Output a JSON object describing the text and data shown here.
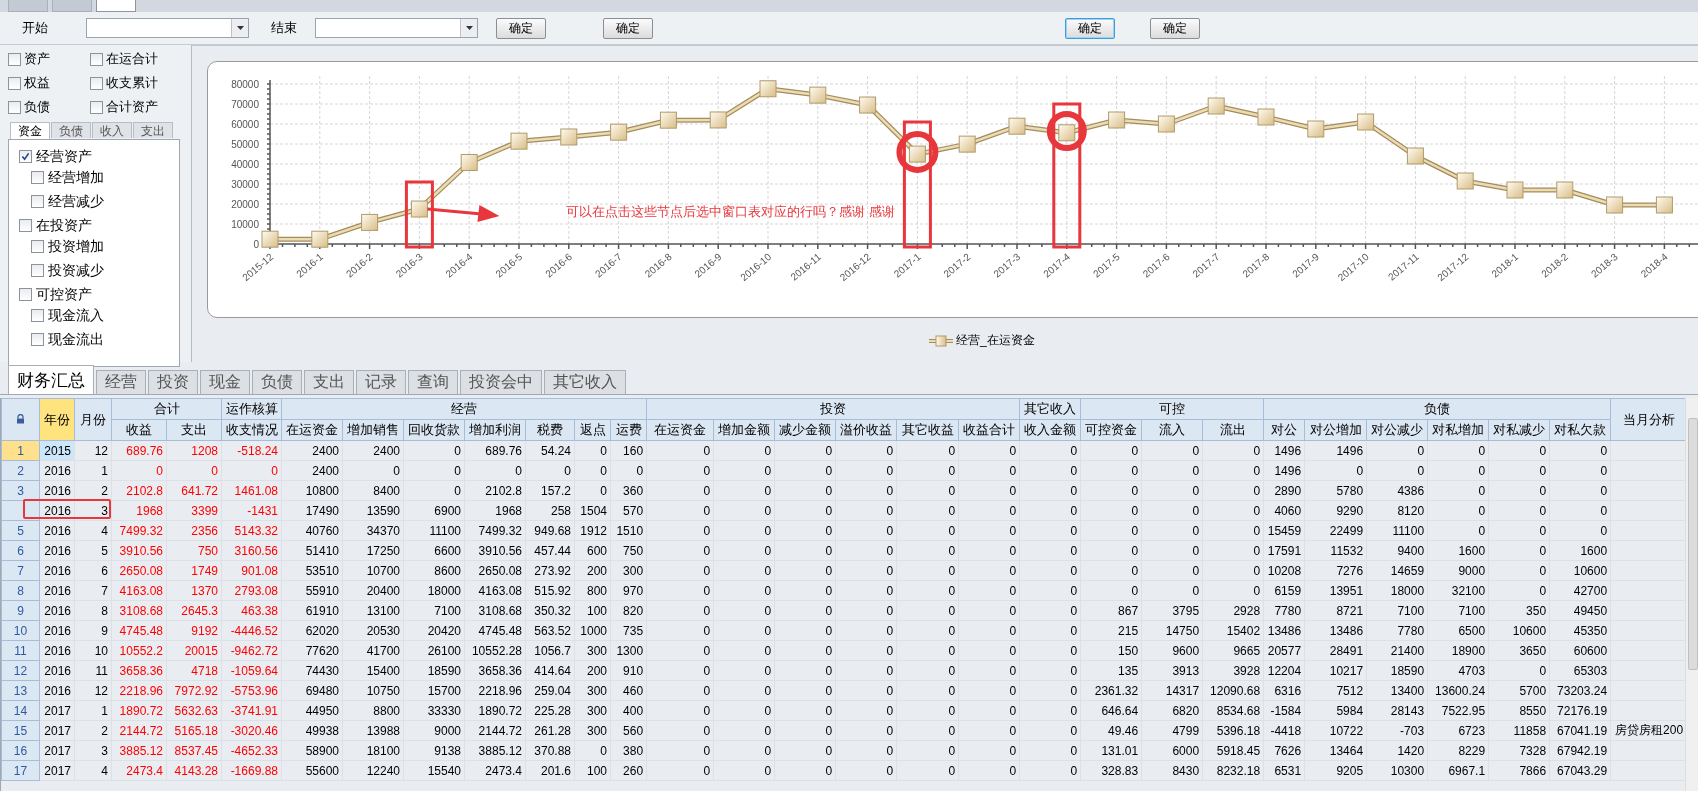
{
  "top_tabs": [
    {
      "selected": false
    },
    {
      "selected": false
    },
    {
      "selected": true
    }
  ],
  "toolbar": {
    "start_label": "开始",
    "end_label": "结束",
    "buttons": [
      {
        "label": "确定",
        "focused": false
      },
      {
        "label": "确定",
        "focused": false
      },
      {
        "label": "确定",
        "focused": true
      },
      {
        "label": "确定",
        "focused": false
      }
    ]
  },
  "left_panel": {
    "options": [
      {
        "label": "资产",
        "checked": false
      },
      {
        "label": "在运合计",
        "checked": false
      },
      {
        "label": "权益",
        "checked": false
      },
      {
        "label": "收支累计",
        "checked": false
      },
      {
        "label": "负债",
        "checked": false
      },
      {
        "label": "合计资产",
        "checked": false
      }
    ],
    "tabs": [
      {
        "label": "资金",
        "selected": true
      },
      {
        "label": "负债",
        "selected": false
      },
      {
        "label": "收入",
        "selected": false
      },
      {
        "label": "支出",
        "selected": false
      }
    ],
    "tree": [
      {
        "label": "经营资产",
        "checked": true,
        "children": [
          {
            "label": "经营增加",
            "checked": false
          },
          {
            "label": "经营减少",
            "checked": false
          }
        ]
      },
      {
        "label": "在投资产",
        "checked": false,
        "children": [
          {
            "label": "投资增加",
            "checked": false
          },
          {
            "label": "投资减少",
            "checked": false
          }
        ]
      },
      {
        "label": "可控资产",
        "checked": false,
        "children": [
          {
            "label": "现金流入",
            "checked": false
          },
          {
            "label": "现金流出",
            "checked": false
          }
        ]
      }
    ]
  },
  "chart_panel": {
    "chart_data": {
      "type": "line",
      "categories": [
        "2015-12",
        "2016-1",
        "2016-2",
        "2016-3",
        "2016-4",
        "2016-5",
        "2016-6",
        "2016-7",
        "2016-8",
        "2016-9",
        "2016-10",
        "2016-11",
        "2016-12",
        "2017-1",
        "2017-2",
        "2017-3",
        "2017-4",
        "2017-5",
        "2017-6",
        "2017-7",
        "2017-8",
        "2017-9",
        "2017-10",
        "2017-11",
        "2017-12",
        "2018-1",
        "2018-2",
        "2018-3",
        "2018-4"
      ],
      "series": [
        {
          "name": "经营_在运资金",
          "color": "#ecdcb4",
          "marker": "square",
          "values": [
            2400,
            2400,
            10800,
            17490,
            40760,
            51410,
            53510,
            55910,
            61910,
            62020,
            77620,
            74430,
            69480,
            44950,
            49938,
            58900,
            55600,
            62000,
            60000,
            69000,
            63500,
            57500,
            61000,
            44000,
            31500,
            27000,
            27000,
            19500,
            19500
          ]
        }
      ],
      "ylim": [
        0,
        80000
      ],
      "yticks": [
        0,
        10000,
        20000,
        30000,
        40000,
        50000,
        60000,
        70000,
        80000
      ],
      "grid": true,
      "annotations": [
        "可以在点击这些节点后选中窗口表对应的行吗？感谢 感谢"
      ]
    }
  },
  "bottom_tabs": [
    {
      "label": "财务汇总",
      "selected": true
    },
    {
      "label": "经营",
      "selected": false
    },
    {
      "label": "投资",
      "selected": false
    },
    {
      "label": "现金",
      "selected": false
    },
    {
      "label": "负债",
      "selected": false
    },
    {
      "label": "支出",
      "selected": false
    },
    {
      "label": "记录",
      "selected": false
    },
    {
      "label": "查询",
      "selected": false
    },
    {
      "label": "投资会中",
      "selected": false
    },
    {
      "label": "其它收入",
      "selected": false
    }
  ],
  "table": {
    "column_groups": [
      {
        "label": "年份",
        "selected": true
      },
      {
        "label": "月份",
        "selected": false
      },
      {
        "label": "合计",
        "selected": false,
        "columns": [
          {
            "label": "收益",
            "emphasis": true
          },
          {
            "label": "支出",
            "emphasis": true
          }
        ]
      },
      {
        "label": "运作核算",
        "selected": false,
        "columns": [
          {
            "label": "收支情况",
            "emphasis": true
          }
        ]
      },
      {
        "label": "经营",
        "selected": false,
        "columns": [
          {
            "label": "在运资金",
            "emphasis": false
          },
          {
            "label": "增加销售",
            "emphasis": false
          },
          {
            "label": "回收货款",
            "emphasis": false
          },
          {
            "label": "增加利润",
            "emphasis": false
          },
          {
            "label": "税费",
            "emphasis": false
          },
          {
            "label": "返点",
            "emphasis": false
          },
          {
            "label": "运费",
            "emphasis": false
          }
        ]
      },
      {
        "label": "投资",
        "selected": false,
        "columns": [
          {
            "label": "在运资金",
            "emphasis": false
          },
          {
            "label": "增加金额",
            "emphasis": false
          },
          {
            "label": "减少金额",
            "emphasis": false
          },
          {
            "label": "溢价收益",
            "emphasis": false
          },
          {
            "label": "其它收益",
            "emphasis": false
          },
          {
            "label": "收益合计",
            "emphasis": false
          }
        ]
      },
      {
        "label": "其它收入",
        "selected": false,
        "columns": [
          {
            "label": "收入金额",
            "emphasis": false
          }
        ]
      },
      {
        "label": "可控",
        "selected": false,
        "columns": [
          {
            "label": "可控资金",
            "emphasis": false
          },
          {
            "label": "流入",
            "emphasis": false
          },
          {
            "label": "流出",
            "emphasis": false
          }
        ]
      },
      {
        "label": "负债",
        "selected": false,
        "columns": [
          {
            "label": "对公",
            "emphasis": false
          },
          {
            "label": "对公增加",
            "emphasis": false
          },
          {
            "label": "对公减少",
            "emphasis": false
          },
          {
            "label": "对私增加",
            "emphasis": false
          },
          {
            "label": "对私减少",
            "emphasis": false
          },
          {
            "label": "对私欠款",
            "emphasis": false
          }
        ]
      },
      {
        "label": "当月分析",
        "selected": false
      }
    ],
    "rows": [
      {
        "no": "1",
        "selected": true,
        "marked": false,
        "cells": [
          "2015",
          "12",
          "689.76",
          "1208",
          "-518.24",
          "2400",
          "2400",
          "0",
          "689.76",
          "54.24",
          "0",
          "160",
          "0",
          "0",
          "0",
          "0",
          "0",
          "0",
          "0",
          "0",
          "0",
          "0",
          "1496",
          "1496",
          "0",
          "0",
          "0",
          "0",
          ""
        ]
      },
      {
        "no": "2",
        "selected": false,
        "marked": false,
        "cells": [
          "2016",
          "1",
          "0",
          "0",
          "0",
          "2400",
          "0",
          "0",
          "0",
          "0",
          "0",
          "0",
          "0",
          "0",
          "0",
          "0",
          "0",
          "0",
          "0",
          "0",
          "0",
          "0",
          "1496",
          "0",
          "0",
          "0",
          "0",
          "0",
          ""
        ]
      },
      {
        "no": "3",
        "selected": false,
        "marked": false,
        "cells": [
          "2016",
          "2",
          "2102.8",
          "641.72",
          "1461.08",
          "10800",
          "8400",
          "0",
          "2102.8",
          "157.2",
          "0",
          "360",
          "0",
          "0",
          "0",
          "0",
          "0",
          "0",
          "0",
          "0",
          "0",
          "0",
          "2890",
          "5780",
          "4386",
          "0",
          "0",
          "0",
          ""
        ]
      },
      {
        "selected": false,
        "marked": true,
        "cells": [
          "2016",
          "3",
          "1968",
          "3399",
          "-1431",
          "17490",
          "13590",
          "6900",
          "1968",
          "258",
          "1504",
          "570",
          "0",
          "0",
          "0",
          "0",
          "0",
          "0",
          "0",
          "0",
          "0",
          "0",
          "4060",
          "9290",
          "8120",
          "0",
          "0",
          "0",
          ""
        ]
      },
      {
        "no": "5",
        "selected": false,
        "marked": false,
        "cells": [
          "2016",
          "4",
          "7499.32",
          "2356",
          "5143.32",
          "40760",
          "34370",
          "11100",
          "7499.32",
          "949.68",
          "1912",
          "1510",
          "0",
          "0",
          "0",
          "0",
          "0",
          "0",
          "0",
          "0",
          "0",
          "0",
          "15459",
          "22499",
          "11100",
          "0",
          "0",
          "0",
          ""
        ]
      },
      {
        "no": "6",
        "selected": false,
        "marked": false,
        "cells": [
          "2016",
          "5",
          "3910.56",
          "750",
          "3160.56",
          "51410",
          "17250",
          "6600",
          "3910.56",
          "457.44",
          "600",
          "750",
          "0",
          "0",
          "0",
          "0",
          "0",
          "0",
          "0",
          "0",
          "0",
          "0",
          "17591",
          "11532",
          "9400",
          "1600",
          "0",
          "1600",
          ""
        ]
      },
      {
        "no": "7",
        "selected": false,
        "marked": false,
        "cells": [
          "2016",
          "6",
          "2650.08",
          "1749",
          "901.08",
          "53510",
          "10700",
          "8600",
          "2650.08",
          "273.92",
          "200",
          "300",
          "0",
          "0",
          "0",
          "0",
          "0",
          "0",
          "0",
          "0",
          "0",
          "0",
          "10208",
          "7276",
          "14659",
          "9000",
          "0",
          "10600",
          ""
        ]
      },
      {
        "no": "8",
        "selected": false,
        "marked": false,
        "cells": [
          "2016",
          "7",
          "4163.08",
          "1370",
          "2793.08",
          "55910",
          "20400",
          "18000",
          "4163.08",
          "515.92",
          "800",
          "970",
          "0",
          "0",
          "0",
          "0",
          "0",
          "0",
          "0",
          "0",
          "0",
          "0",
          "6159",
          "13951",
          "18000",
          "32100",
          "0",
          "42700",
          ""
        ]
      },
      {
        "no": "9",
        "selected": false,
        "marked": false,
        "cells": [
          "2016",
          "8",
          "3108.68",
          "2645.3",
          "463.38",
          "61910",
          "13100",
          "7100",
          "3108.68",
          "350.32",
          "100",
          "820",
          "0",
          "0",
          "0",
          "0",
          "0",
          "0",
          "0",
          "867",
          "3795",
          "2928",
          "7780",
          "8721",
          "7100",
          "7100",
          "350",
          "49450",
          ""
        ]
      },
      {
        "no": "10",
        "selected": false,
        "marked": false,
        "cells": [
          "2016",
          "9",
          "4745.48",
          "9192",
          "-4446.52",
          "62020",
          "20530",
          "20420",
          "4745.48",
          "563.52",
          "1000",
          "735",
          "0",
          "0",
          "0",
          "0",
          "0",
          "0",
          "0",
          "215",
          "14750",
          "15402",
          "13486",
          "13486",
          "7780",
          "6500",
          "10600",
          "45350",
          ""
        ]
      },
      {
        "no": "11",
        "selected": false,
        "marked": false,
        "cells": [
          "2016",
          "10",
          "10552.2",
          "20015",
          "-9462.72",
          "77620",
          "41700",
          "26100",
          "10552.28",
          "1056.7",
          "300",
          "1300",
          "0",
          "0",
          "0",
          "0",
          "0",
          "0",
          "0",
          "150",
          "9600",
          "9665",
          "20577",
          "28491",
          "21400",
          "18900",
          "3650",
          "60600",
          ""
        ]
      },
      {
        "no": "12",
        "selected": false,
        "marked": false,
        "cells": [
          "2016",
          "11",
          "3658.36",
          "4718",
          "-1059.64",
          "74430",
          "15400",
          "18590",
          "3658.36",
          "414.64",
          "200",
          "910",
          "0",
          "0",
          "0",
          "0",
          "0",
          "0",
          "0",
          "135",
          "3913",
          "3928",
          "12204",
          "10217",
          "18590",
          "4703",
          "0",
          "65303",
          ""
        ]
      },
      {
        "no": "13",
        "selected": false,
        "marked": false,
        "cells": [
          "2016",
          "12",
          "2218.96",
          "7972.92",
          "-5753.96",
          "69480",
          "10750",
          "15700",
          "2218.96",
          "259.04",
          "300",
          "460",
          "0",
          "0",
          "0",
          "0",
          "0",
          "0",
          "0",
          "2361.32",
          "14317",
          "12090.68",
          "6316",
          "7512",
          "13400",
          "13600.24",
          "5700",
          "73203.24",
          ""
        ]
      },
      {
        "no": "14",
        "selected": false,
        "marked": false,
        "cells": [
          "2017",
          "1",
          "1890.72",
          "5632.63",
          "-3741.91",
          "44950",
          "8800",
          "33330",
          "1890.72",
          "225.28",
          "300",
          "400",
          "0",
          "0",
          "0",
          "0",
          "0",
          "0",
          "0",
          "646.64",
          "6820",
          "8534.68",
          "-1584",
          "5984",
          "28143",
          "7522.95",
          "8550",
          "72176.19",
          ""
        ]
      },
      {
        "no": "15",
        "selected": false,
        "marked": false,
        "cells": [
          "2017",
          "2",
          "2144.72",
          "5165.18",
          "-3020.46",
          "49938",
          "13988",
          "9000",
          "2144.72",
          "261.28",
          "300",
          "560",
          "0",
          "0",
          "0",
          "0",
          "0",
          "0",
          "0",
          "49.46",
          "4799",
          "5396.18",
          "-4418",
          "10722",
          "-703",
          "6723",
          "11858",
          "67041.19",
          "房贷房租200"
        ]
      },
      {
        "no": "16",
        "selected": false,
        "marked": false,
        "cells": [
          "2017",
          "3",
          "3885.12",
          "8537.45",
          "-4652.33",
          "58900",
          "18100",
          "9138",
          "3885.12",
          "370.88",
          "0",
          "380",
          "0",
          "0",
          "0",
          "0",
          "0",
          "0",
          "0",
          "131.01",
          "6000",
          "5918.45",
          "7626",
          "13464",
          "1420",
          "8229",
          "7328",
          "67942.19",
          ""
        ]
      },
      {
        "no": "17",
        "selected": false,
        "marked": false,
        "cells": [
          "2017",
          "4",
          "2473.4",
          "4143.28",
          "-1669.88",
          "55600",
          "12240",
          "15540",
          "2473.4",
          "201.6",
          "100",
          "260",
          "0",
          "0",
          "0",
          "0",
          "0",
          "0",
          "0",
          "328.83",
          "8430",
          "8232.18",
          "6531",
          "9205",
          "10300",
          "6967.1",
          "7866",
          "67043.29",
          ""
        ]
      }
    ]
  }
}
